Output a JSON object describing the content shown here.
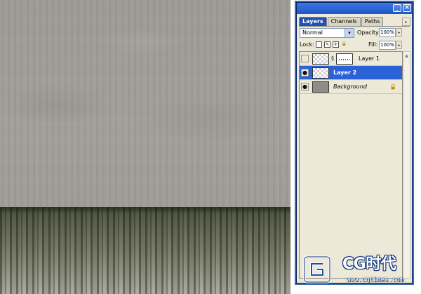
{
  "palette": {
    "tabs": [
      {
        "label": "Layers",
        "active": true
      },
      {
        "label": "Channels",
        "active": false
      },
      {
        "label": "Paths",
        "active": false
      }
    ],
    "blend_mode": "Normal",
    "opacity_label": "Opacity:",
    "opacity_value": "100%",
    "lock_label": "Lock:",
    "fill_label": "Fill:",
    "fill_value": "100%",
    "layers": [
      {
        "name": "Layer 1",
        "visible": false,
        "selected": false,
        "has_mask": true
      },
      {
        "name": "Layer 2",
        "visible": true,
        "selected": true,
        "has_mask": false
      },
      {
        "name": "Background",
        "visible": true,
        "selected": false,
        "locked": true
      }
    ]
  },
  "watermark": {
    "brand": "CG时代",
    "url": "www.cgtimes.com"
  },
  "colors": {
    "selection": "#2b62d8",
    "titlebar": "#1e55c6",
    "panel_bg": "#ece9d8"
  }
}
